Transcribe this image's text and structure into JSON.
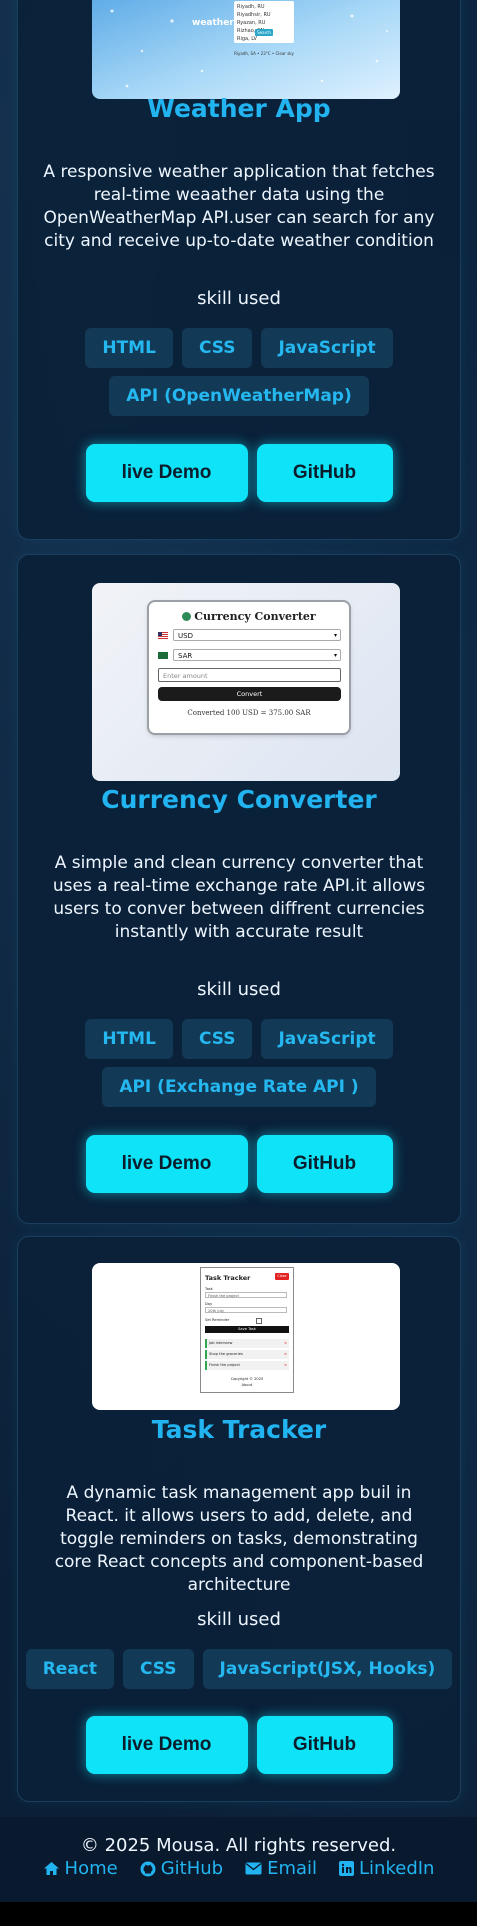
{
  "projects": [
    {
      "title": "Weather App",
      "description": "A responsive weather application that fetches real-time weaather data using the OpenWeatherMap API.user can search for any city and receive up-to-date weather condition",
      "skills_heading": "skill used",
      "skills": [
        "HTML",
        "CSS",
        "JavaScript",
        "API (OpenWeatherMap)"
      ],
      "demo_label": "live Demo",
      "github_label": "GitHub",
      "thumb": {
        "heading": "weatherApp",
        "rows": [
          "Riyadh, RU",
          "Riyadhsir, RU",
          "Ryazan, RU",
          "Rizhao, CN",
          "Riga, LV"
        ],
        "button": "Search",
        "footer": "Riyadh, SA • 23°C • Clear sky"
      }
    },
    {
      "title": "Currency Converter",
      "description": "A simple and clean currency converter that uses a real-time exchange rate API.it allows users to conver between diffrent currencies instantly with accurate result",
      "skills_heading": "skill used",
      "skills": [
        "HTML",
        "CSS",
        "JavaScript",
        "API (Exchange Rate API )"
      ],
      "demo_label": "live Demo",
      "github_label": "GitHub",
      "thumb": {
        "heading": "Currency Converter",
        "from": "USD",
        "to": "SAR",
        "placeholder": "Enter amount",
        "button": "Convert",
        "result": "Converted 100 USD = 375.00 SAR"
      }
    },
    {
      "title": "Task Tracker",
      "description": "A dynamic task management app buil in React. it allows users to add, delete, and toggle reminders on tasks, demonstrating core React concepts and component-based architecture",
      "skills_heading": "skill used",
      "skills": [
        "React",
        "CSS",
        "JavaScript(JSX, Hooks)"
      ],
      "demo_label": "live Demo",
      "github_label": "GitHub",
      "thumb": {
        "heading": "Task Tracker",
        "close": "Close",
        "task_label": "Task",
        "task_value": "Finish the project",
        "day_label": "Day",
        "day_value": "20th July",
        "reminder_label": "Set Reminder",
        "save": "Save Task",
        "tasks": [
          "Job Interview",
          "Shop the groceries",
          "Finish the project"
        ],
        "copyright": "Copyright © 2025",
        "about": "About"
      }
    }
  ],
  "footer": {
    "copyright": "© 2025 Mousa. All rights reserved.",
    "links": [
      "Home",
      "GitHub",
      "Email",
      "LinkedIn"
    ]
  },
  "colors": {
    "accent": "#22b4f0",
    "button": "#0fe3f7",
    "background": "#0b2138"
  }
}
